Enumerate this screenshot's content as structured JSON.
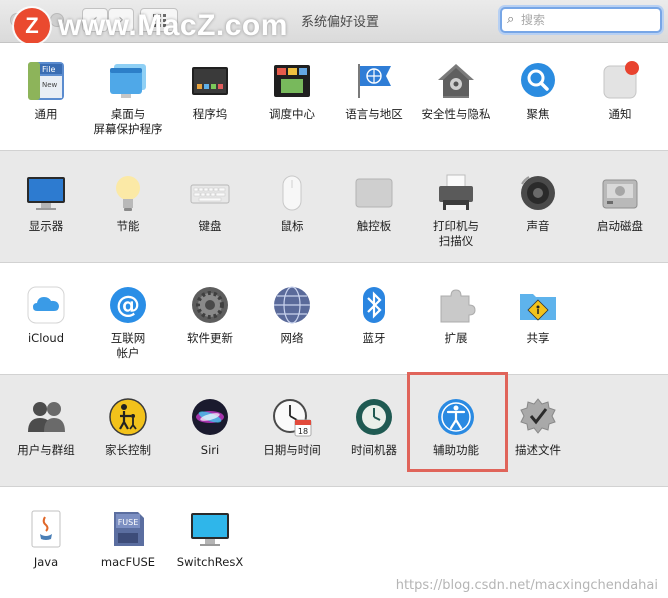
{
  "window": {
    "title": "系统偏好设置"
  },
  "search": {
    "placeholder": "搜索"
  },
  "watermark": {
    "text": "www.MacZ.com",
    "logo_letter": "Z"
  },
  "rows": [
    [
      "通用",
      "桌面与\n屏幕保护程序",
      "程序坞",
      "调度中心",
      "语言与地区",
      "安全性与隐私",
      "聚焦",
      "通知"
    ],
    [
      "显示器",
      "节能",
      "键盘",
      "鼠标",
      "触控板",
      "打印机与\n扫描仪",
      "声音",
      "启动磁盘"
    ],
    [
      "iCloud",
      "互联网\n帐户",
      "软件更新",
      "网络",
      "蓝牙",
      "扩展",
      "共享"
    ],
    [
      "用户与群组",
      "家长控制",
      "Siri",
      "日期与时间",
      "时间机器",
      "辅助功能",
      "描述文件"
    ],
    [
      "Java",
      "macFUSE",
      "SwitchResX"
    ]
  ],
  "icon_text": {
    "general_file": "File",
    "general_new": "New",
    "calendar_day": "18",
    "fuse": "FUSE"
  },
  "footer_url": "https://blog.csdn.net/macxingchendahai",
  "colors": {
    "highlight": "#e0645a",
    "search_focus": "#77a6e6",
    "watermark_logo": "#ea4a2f"
  }
}
